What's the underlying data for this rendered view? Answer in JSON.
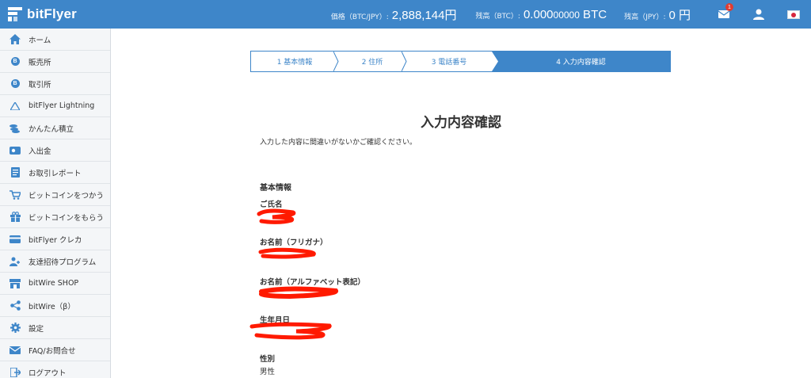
{
  "header": {
    "logo_text": "bitFlyer",
    "price_label": "価格（BTC/JPY）:",
    "price_value": "2,888,144円",
    "btc_balance_label": "残高（BTC）:",
    "btc_balance_main": "0.000",
    "btc_balance_small": "00000",
    "btc_balance_unit": " BTC",
    "jpy_balance_label": "残高（JPY）:",
    "jpy_balance_value": "0 円",
    "mail_badge": "1"
  },
  "sidebar": {
    "items": [
      {
        "label": "ホーム",
        "icon": "home-icon"
      },
      {
        "label": "販売所",
        "icon": "bitcoin-icon"
      },
      {
        "label": "取引所",
        "icon": "bitcoin-icon"
      },
      {
        "label": "bitFlyer Lightning",
        "icon": "lightning-icon"
      },
      {
        "label": "かんたん積立",
        "icon": "coin-stack-icon"
      },
      {
        "label": "入出金",
        "icon": "wallet-icon"
      },
      {
        "label": "お取引レポート",
        "icon": "report-icon"
      },
      {
        "label": "ビットコインをつかう",
        "icon": "cart-icon"
      },
      {
        "label": "ビットコインをもらう",
        "icon": "gift-icon"
      },
      {
        "label": "bitFlyer クレカ",
        "icon": "credit-card-icon"
      },
      {
        "label": "友達招待プログラム",
        "icon": "invite-icon"
      },
      {
        "label": "bitWire SHOP",
        "icon": "shop-icon"
      },
      {
        "label": "bitWire（β）",
        "icon": "share-icon"
      },
      {
        "label": "設定",
        "icon": "gear-icon"
      },
      {
        "label": "FAQ/お問合せ",
        "icon": "mail-icon"
      },
      {
        "label": "ログアウト",
        "icon": "logout-icon"
      }
    ]
  },
  "steps": [
    {
      "label": "1 基本情報"
    },
    {
      "label": "2 住所"
    },
    {
      "label": "3 電話番号"
    },
    {
      "label": "4 入力内容確認"
    }
  ],
  "main": {
    "title": "入力内容確認",
    "description": "入力した内容に間違いがないかご確認ください。",
    "section_title": "基本情報",
    "fields": {
      "name_label": "ご氏名",
      "furigana_label": "お名前（フリガナ）",
      "alphabet_label": "お名前（アルファベット表記）",
      "birthdate_label": "生年月日",
      "gender_label": "性別",
      "gender_value": "男性"
    }
  },
  "colors": {
    "brand": "#3e86c9",
    "redaction": "#ff1a00",
    "badge": "#e03c31"
  }
}
